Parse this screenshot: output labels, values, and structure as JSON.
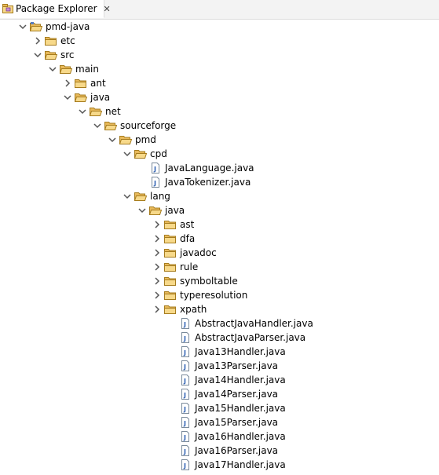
{
  "view": {
    "tab_title": "Package Explorer",
    "tab_icon": "package-explorer-icon",
    "close_icon": "close-icon"
  },
  "tree": [
    {
      "label": "pmd-java",
      "kind": "project",
      "expand": "open",
      "depth": 0
    },
    {
      "label": "etc",
      "kind": "folder",
      "expand": "closed",
      "depth": 1
    },
    {
      "label": "src",
      "kind": "folder",
      "expand": "open",
      "depth": 1
    },
    {
      "label": "main",
      "kind": "folder",
      "expand": "open",
      "depth": 2
    },
    {
      "label": "ant",
      "kind": "folder",
      "expand": "closed",
      "depth": 3
    },
    {
      "label": "java",
      "kind": "folder",
      "expand": "open",
      "depth": 3
    },
    {
      "label": "net",
      "kind": "folder",
      "expand": "open",
      "depth": 4
    },
    {
      "label": "sourceforge",
      "kind": "folder",
      "expand": "open",
      "depth": 5
    },
    {
      "label": "pmd",
      "kind": "folder",
      "expand": "open",
      "depth": 6
    },
    {
      "label": "cpd",
      "kind": "folder",
      "expand": "open",
      "depth": 7
    },
    {
      "label": "JavaLanguage.java",
      "kind": "file",
      "expand": "none",
      "depth": 8
    },
    {
      "label": "JavaTokenizer.java",
      "kind": "file",
      "expand": "none",
      "depth": 8
    },
    {
      "label": "lang",
      "kind": "folder",
      "expand": "open",
      "depth": 7
    },
    {
      "label": "java",
      "kind": "folder",
      "expand": "open",
      "depth": 8
    },
    {
      "label": "ast",
      "kind": "folder",
      "expand": "closed",
      "depth": 9
    },
    {
      "label": "dfa",
      "kind": "folder",
      "expand": "closed",
      "depth": 9
    },
    {
      "label": "javadoc",
      "kind": "folder",
      "expand": "closed",
      "depth": 9
    },
    {
      "label": "rule",
      "kind": "folder",
      "expand": "closed",
      "depth": 9
    },
    {
      "label": "symboltable",
      "kind": "folder",
      "expand": "closed",
      "depth": 9
    },
    {
      "label": "typeresolution",
      "kind": "folder",
      "expand": "closed",
      "depth": 9
    },
    {
      "label": "xpath",
      "kind": "folder",
      "expand": "closed",
      "depth": 9
    },
    {
      "label": "AbstractJavaHandler.java",
      "kind": "file",
      "expand": "none",
      "depth": 10
    },
    {
      "label": "AbstractJavaParser.java",
      "kind": "file",
      "expand": "none",
      "depth": 10
    },
    {
      "label": "Java13Handler.java",
      "kind": "file",
      "expand": "none",
      "depth": 10
    },
    {
      "label": "Java13Parser.java",
      "kind": "file",
      "expand": "none",
      "depth": 10
    },
    {
      "label": "Java14Handler.java",
      "kind": "file",
      "expand": "none",
      "depth": 10
    },
    {
      "label": "Java14Parser.java",
      "kind": "file",
      "expand": "none",
      "depth": 10
    },
    {
      "label": "Java15Handler.java",
      "kind": "file",
      "expand": "none",
      "depth": 10
    },
    {
      "label": "Java15Parser.java",
      "kind": "file",
      "expand": "none",
      "depth": 10
    },
    {
      "label": "Java16Handler.java",
      "kind": "file",
      "expand": "none",
      "depth": 10
    },
    {
      "label": "Java16Parser.java",
      "kind": "file",
      "expand": "none",
      "depth": 10
    },
    {
      "label": "Java17Handler.java",
      "kind": "file",
      "expand": "none",
      "depth": 10
    }
  ],
  "colors": {
    "folder_body": "#e8b95a",
    "folder_front": "#f7d98a",
    "folder_outline": "#a67c1e",
    "chevron": "#555555",
    "file_j": "#2a5db0"
  }
}
